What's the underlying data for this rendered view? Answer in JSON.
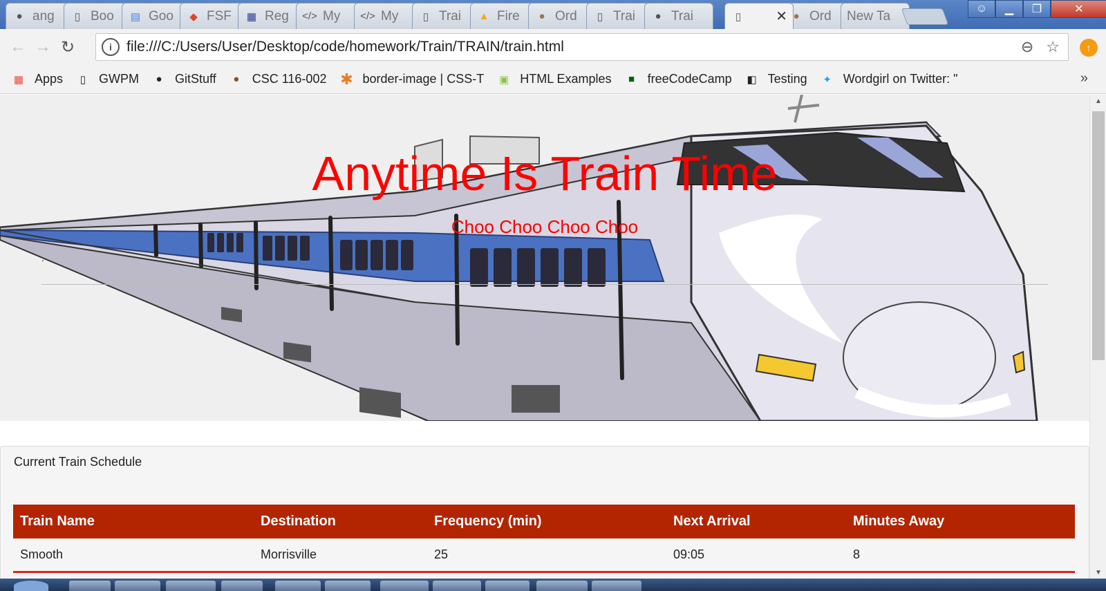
{
  "browser": {
    "tabs": [
      {
        "title": "ang",
        "icon": "github-icon"
      },
      {
        "title": "Boo",
        "icon": "document-icon"
      },
      {
        "title": "Goo",
        "icon": "google-docs-icon"
      },
      {
        "title": "FSF",
        "icon": "gitlab-icon"
      },
      {
        "title": "Reg",
        "icon": "dmv-icon"
      },
      {
        "title": "My",
        "icon": "code-icon"
      },
      {
        "title": "My",
        "icon": "code-icon"
      },
      {
        "title": "Trai",
        "icon": "document-icon"
      },
      {
        "title": "Fire",
        "icon": "firebase-icon"
      },
      {
        "title": "Ord",
        "icon": "ordinance-icon"
      },
      {
        "title": "Trai",
        "icon": "document-icon"
      },
      {
        "title": "Trai",
        "icon": "github-icon"
      },
      {
        "title": "",
        "icon": "document-icon",
        "active": true
      },
      {
        "title": "Ord",
        "icon": "ordinance-icon"
      },
      {
        "title": "New Ta",
        "icon": ""
      }
    ],
    "url": "file:///C:/Users/User/Desktop/code/homework/Train/TRAIN/train.html",
    "bookmarks": [
      {
        "label": "Apps",
        "icon": "apps-grid-icon"
      },
      {
        "label": "GWPM",
        "icon": "document-icon"
      },
      {
        "label": "GitStuff",
        "icon": "github-icon"
      },
      {
        "label": "CSC 116-002",
        "icon": "csc-icon"
      },
      {
        "label": "border-image | CSS-T",
        "icon": "asterisk-icon"
      },
      {
        "label": "HTML Examples",
        "icon": "w3-icon"
      },
      {
        "label": "freeCodeCamp",
        "icon": "freecodecamp-icon"
      },
      {
        "label": "Testing",
        "icon": "testing-icon"
      },
      {
        "label": "Wordgirl on Twitter: \"",
        "icon": "twitter-icon"
      }
    ],
    "bookmarks_more": "»"
  },
  "page": {
    "title": "Anytime Is Train Time",
    "subtitle": "Choo Choo Choo Choo",
    "dot": ".",
    "schedule_heading": "Current Train Schedule",
    "table": {
      "headers": [
        "Train Name",
        "Destination",
        "Frequency (min)",
        "Next Arrival",
        "Minutes Away"
      ],
      "rows": [
        [
          "Smooth",
          "Morrisville",
          "25",
          "09:05",
          "8"
        ]
      ]
    }
  },
  "colors": {
    "title": "#ff0000",
    "table_header": "#b22500",
    "row_border": "#e02020"
  }
}
